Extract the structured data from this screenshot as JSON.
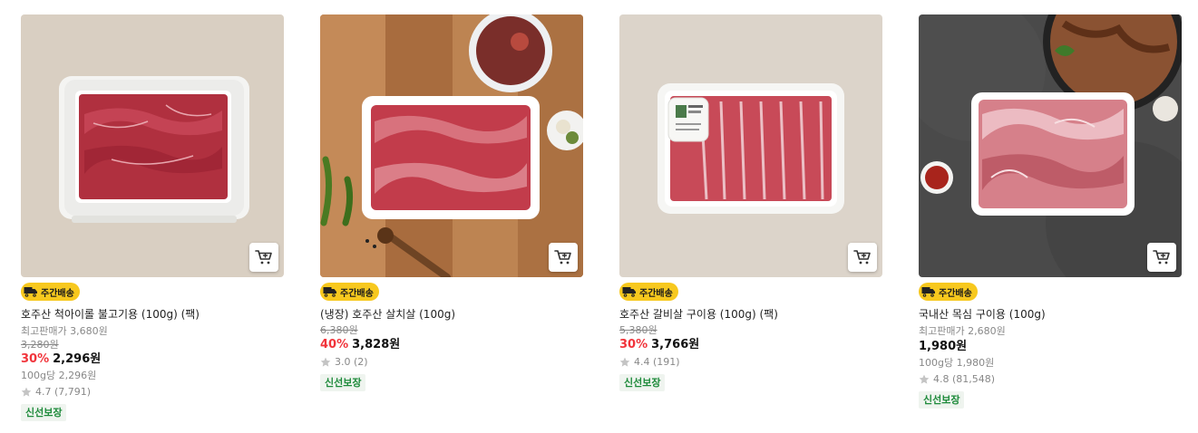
{
  "products": [
    {
      "badge": "주간배송",
      "name": "호주산 척아이롤 불고기용 (100g) (팩)",
      "max_price_label": "최고판매가 3,680원",
      "original_price": "3,280원",
      "discount": "30%",
      "price": "2,296원",
      "unit_price": "100g당 2,296원",
      "rating": "4.7 (7,791)",
      "tag": "신선보장"
    },
    {
      "badge": "주간배송",
      "name": "(냉장) 호주산 살치살 (100g)",
      "original_price": "6,380원",
      "discount": "40%",
      "price": "3,828원",
      "rating": "3.0 (2)",
      "tag": "신선보장"
    },
    {
      "badge": "주간배송",
      "name": "호주산 갈비살 구이용 (100g) (팩)",
      "original_price": "5,380원",
      "discount": "30%",
      "price": "3,766원",
      "rating": "4.4 (191)",
      "tag": "신선보장"
    },
    {
      "badge": "주간배송",
      "name": "국내산 목심 구이용 (100g)",
      "max_price_label": "최고판매가 2,680원",
      "price": "1,980원",
      "unit_price": "100g당 1,980원",
      "rating": "4.8 (81,548)",
      "tag": "신선보장"
    }
  ],
  "colors": {
    "badge_bg": "#f7c81e",
    "discount": "#f1343b",
    "fresh_tag_text": "#1d8a3a",
    "fresh_tag_bg": "#eff4ef"
  },
  "icons": {
    "cart": "cart-icon",
    "truck": "truck-icon",
    "star": "star-icon"
  }
}
